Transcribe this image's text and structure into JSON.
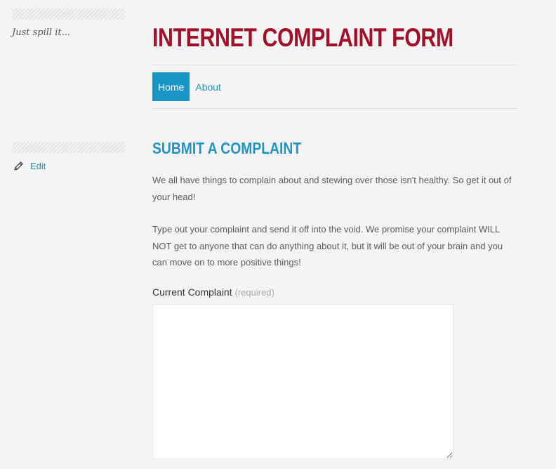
{
  "sidebar": {
    "tagline": "Just spill it...",
    "edit_label": "Edit"
  },
  "header": {
    "site_title": "INTERNET COMPLAINT FORM"
  },
  "nav": {
    "items": [
      {
        "label": "Home",
        "active": true
      },
      {
        "label": "About",
        "active": false
      }
    ]
  },
  "main": {
    "heading": "SUBMIT A COMPLAINT",
    "paragraph_1": "We all have things to complain about and stewing over those isn't healthy. So get it out of your head!",
    "paragraph_2": "Type out your complaint and send it off into the void. We promise your complaint WILL NOT get to anyone that can do anything about it, but it will be out of your brain and you can move on to more positive things!",
    "form": {
      "field_label": "Current Complaint",
      "required_note": "(required)",
      "complaint_value": ""
    }
  },
  "colors": {
    "title_red": "#a1102a",
    "accent_blue": "#1b94c8",
    "background": "#f4f4f4"
  },
  "icons": {
    "edit": "pencil-icon"
  }
}
